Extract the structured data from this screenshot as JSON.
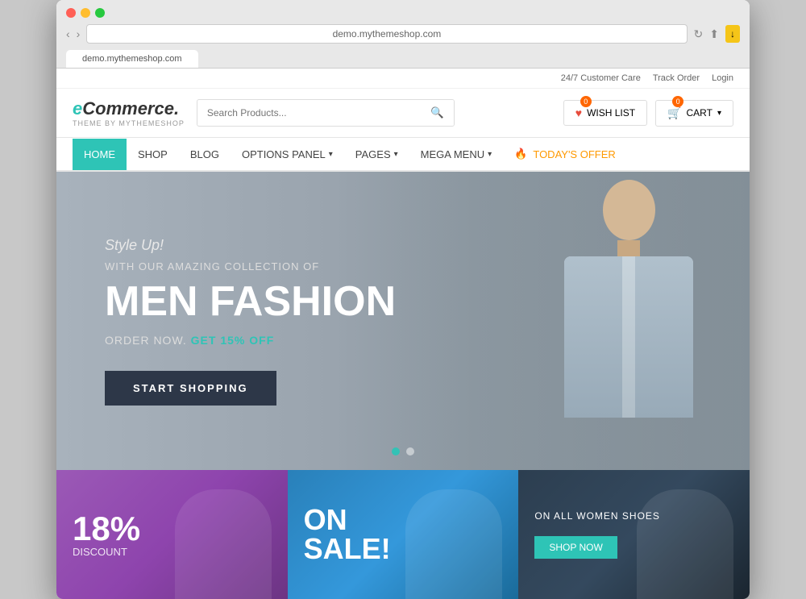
{
  "browser": {
    "address": "demo.mythemeshop.com",
    "tab_label": "demo.mythemeshop.com",
    "download_icon": "↓"
  },
  "header": {
    "customer_care": "24/7 Customer Care",
    "track_order": "Track Order",
    "login": "Login",
    "logo_e": "e",
    "logo_commerce": "Commerce.",
    "logo_sub": "THEME BY MYTHEMESHOP",
    "search_placeholder": "Search Products...",
    "wishlist_label": "WISH LIST",
    "wishlist_badge": "0",
    "cart_label": "CART",
    "cart_badge": "0"
  },
  "nav": {
    "items": [
      {
        "label": "HOME",
        "active": true
      },
      {
        "label": "SHOP",
        "active": false
      },
      {
        "label": "BLOG",
        "active": false
      },
      {
        "label": "OPTIONS PANEL",
        "has_dropdown": true,
        "active": false
      },
      {
        "label": "PAGES",
        "has_dropdown": true,
        "active": false
      },
      {
        "label": "MEGA MENU",
        "has_dropdown": true,
        "active": false
      },
      {
        "label": "TODAY'S OFFER",
        "is_offer": true,
        "active": false
      }
    ]
  },
  "hero": {
    "subtitle": "Style Up!",
    "tagline": "WITH OUR AMAZING COLLECTION OF",
    "title": "MEN FASHION",
    "offer_text": "ORDER NOW.",
    "offer_highlight": "GET 15% OFF",
    "cta_button": "START SHOPPING",
    "dot1_active": true,
    "dot2_active": false
  },
  "promo": {
    "card1": {
      "percent": "18%",
      "label": "DISCOUNT"
    },
    "card2": {
      "on": "ON",
      "sale": "SALE!"
    },
    "card3": {
      "top_label": "ON ALL WOMEN SHOES",
      "shop_btn": "SHOP NOW"
    }
  }
}
